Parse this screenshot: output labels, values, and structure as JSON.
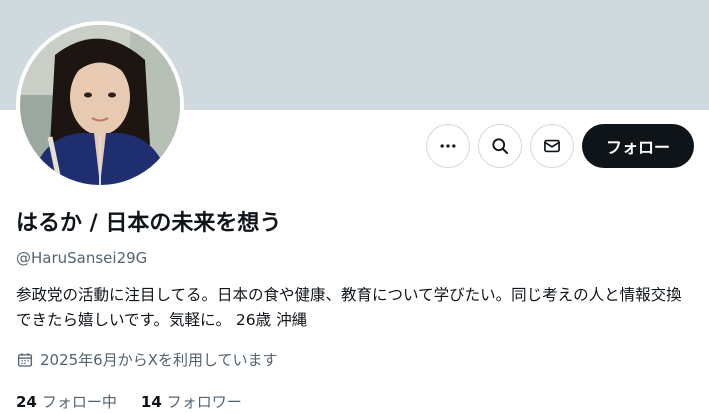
{
  "profile": {
    "display_name": "はるか / 日本の未来を想う",
    "handle": "@HaruSansei29G",
    "bio": "参政党の活動に注目してる。日本の食や健康、教育について学びたい。同じ考えの人と情報交換できたら嬉しいです。気軽に。 26歳 沖縄",
    "joined": "2025年6月からXを利用しています"
  },
  "actions": {
    "more_icon": "more-icon",
    "search_icon": "search-icon",
    "message_icon": "envelope-icon",
    "follow_label": "フォロー"
  },
  "stats": {
    "following_count": "24",
    "following_label": "フォロー中",
    "followers_count": "14",
    "followers_label": "フォロワー"
  },
  "colors": {
    "banner": "#cfd9de",
    "primary_text": "#0f1419",
    "secondary_text": "#536471",
    "follow_button": "#0f1419"
  }
}
